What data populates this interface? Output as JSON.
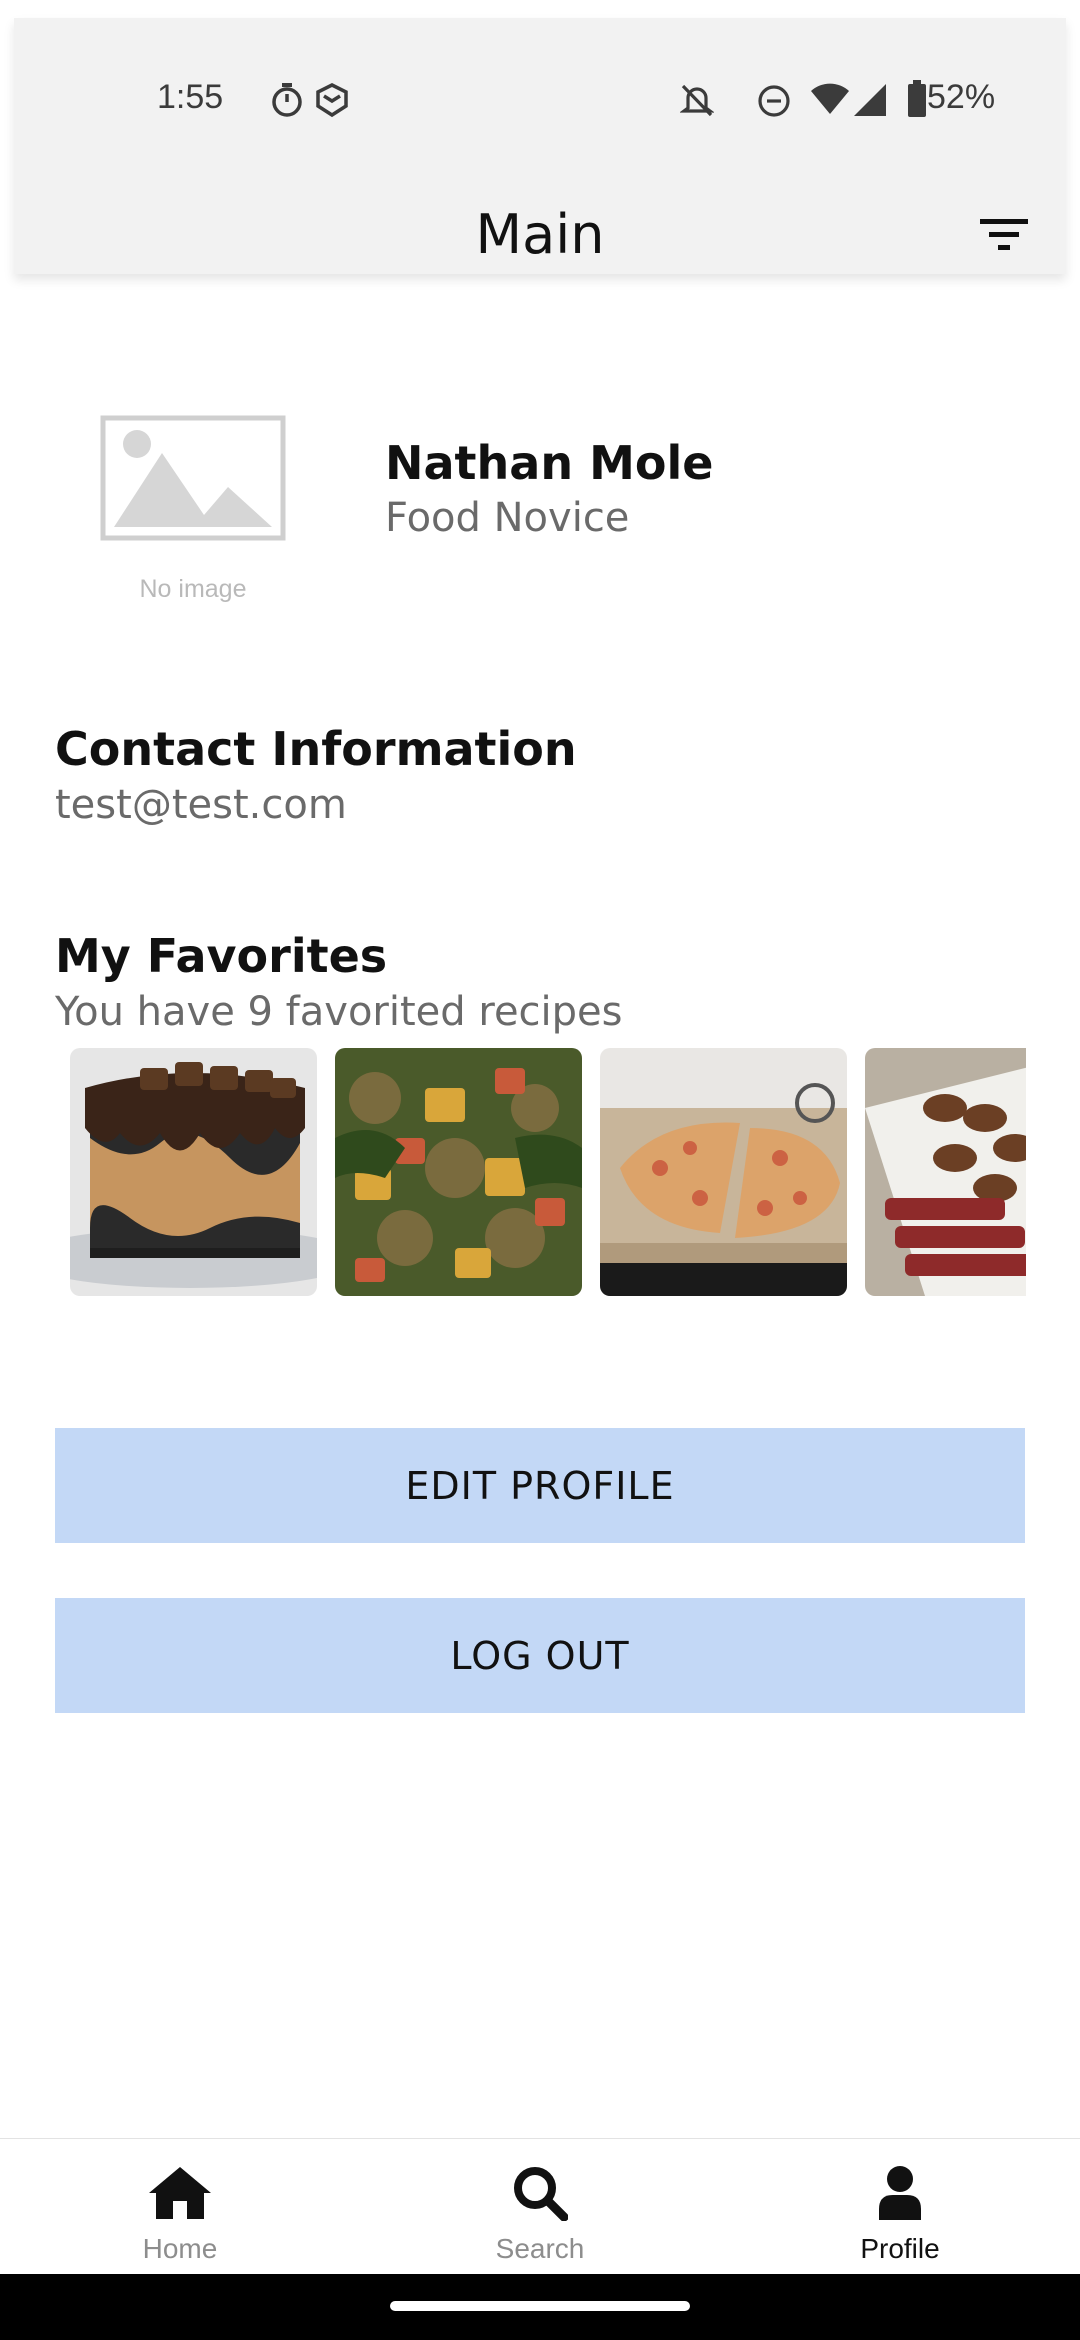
{
  "status_bar": {
    "time": "1:55",
    "battery_percent": "52%",
    "icons": [
      "timer-icon",
      "shield-app-icon",
      "bell-off-icon",
      "do-not-disturb-icon",
      "wifi-icon",
      "cell-signal-icon",
      "battery-icon"
    ]
  },
  "app_bar": {
    "title": "Main",
    "filter_icon": "filter-icon"
  },
  "profile": {
    "avatar_placeholder": "No image",
    "name": "Nathan Mole",
    "level": "Food Novice"
  },
  "contact": {
    "title": "Contact Information",
    "email": "test@test.com"
  },
  "favorites": {
    "title": "My Favorites",
    "subtitle": "You have 9 favorited recipes",
    "thumbnails": [
      "chocolate-peanut-butter-cake",
      "roasted-vegetables-greens",
      "cauliflower-crust-pizza",
      "sliced-steak-mushrooms"
    ]
  },
  "buttons": {
    "edit_profile": "EDIT PROFILE",
    "log_out": "LOG OUT"
  },
  "bottom_nav": {
    "items": [
      {
        "label": "Home",
        "icon": "home-icon"
      },
      {
        "label": "Search",
        "icon": "search-icon"
      },
      {
        "label": "Profile",
        "icon": "person-icon"
      }
    ],
    "active": "Profile"
  },
  "colors": {
    "button_bg": "#c3d8f6",
    "appbar_bg": "#f2f2f2",
    "muted_text": "#6a6a6a"
  }
}
